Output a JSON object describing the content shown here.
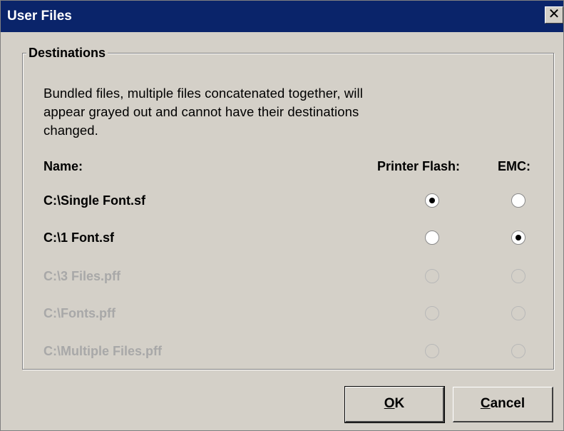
{
  "window": {
    "title": "User Files",
    "close_glyph": "✕"
  },
  "group": {
    "legend": "Destinations",
    "description": "Bundled files, multiple files concatenated together, will appear grayed out and cannot have their destinations changed."
  },
  "columns": {
    "name": "Name:",
    "printer_flash": "Printer Flash:",
    "emc": "EMC:"
  },
  "files": [
    {
      "name": "C:\\Single Font.sf",
      "enabled": true,
      "destination": "Printer Flash"
    },
    {
      "name": "C:\\1 Font.sf",
      "enabled": true,
      "destination": "EMC"
    },
    {
      "name": "C:\\3 Files.pff",
      "enabled": false,
      "destination": ""
    },
    {
      "name": "C:\\Fonts.pff",
      "enabled": false,
      "destination": ""
    },
    {
      "name": "C:\\Multiple Files.pff",
      "enabled": false,
      "destination": ""
    }
  ],
  "buttons": {
    "ok_mnemonic": "O",
    "ok_rest": "K",
    "cancel_mnemonic": "C",
    "cancel_rest": "ancel"
  },
  "colors": {
    "titlebar": "#0a246a",
    "dialog_bg": "#d4d0c8",
    "disabled_text": "#a8a8a8"
  }
}
